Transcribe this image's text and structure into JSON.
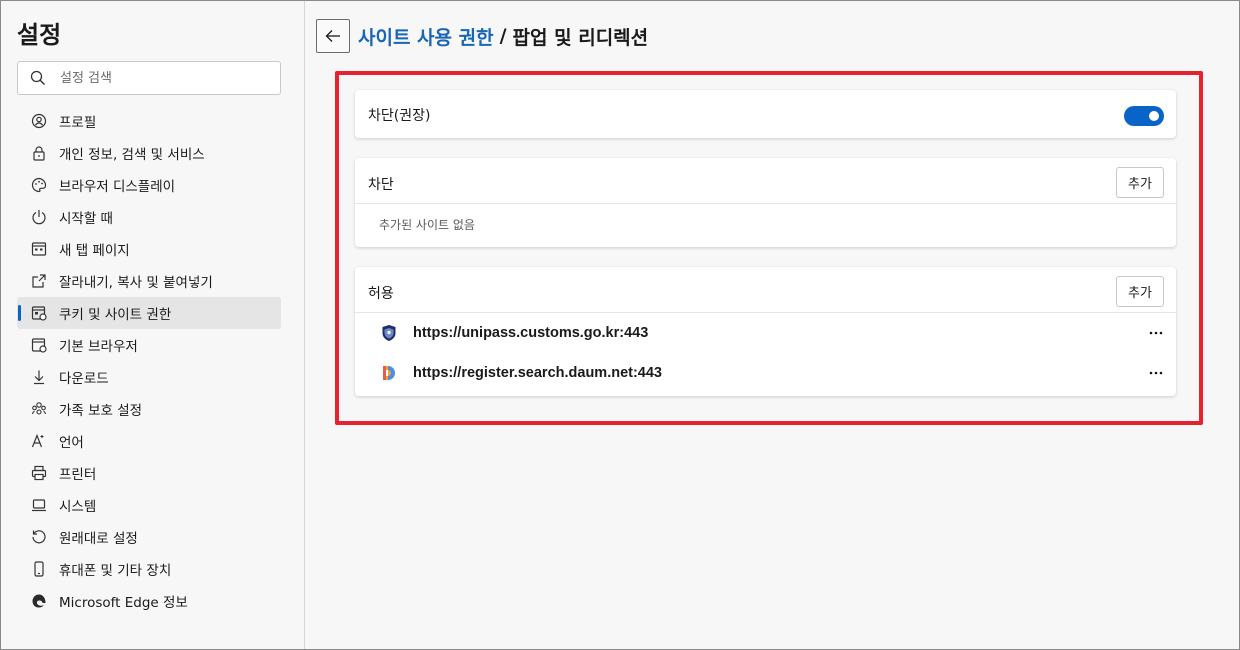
{
  "sidebar": {
    "title": "설정",
    "search_placeholder": "설정 검색",
    "items": [
      {
        "label": "프로필",
        "icon": "profile-icon"
      },
      {
        "label": "개인 정보, 검색 및 서비스",
        "icon": "lock-icon"
      },
      {
        "label": "브라우저 디스플레이",
        "icon": "palette-icon"
      },
      {
        "label": "시작할 때",
        "icon": "power-icon"
      },
      {
        "label": "새 탭 페이지",
        "icon": "grid-icon"
      },
      {
        "label": "잘라내기, 복사 및 붙여넣기",
        "icon": "share-icon"
      },
      {
        "label": "쿠키 및 사이트 권한",
        "icon": "cookie-permissions-icon"
      },
      {
        "label": "기본 브라우저",
        "icon": "browser-icon"
      },
      {
        "label": "다운로드",
        "icon": "download-icon"
      },
      {
        "label": "가족 보호 설정",
        "icon": "family-icon"
      },
      {
        "label": "언어",
        "icon": "language-icon"
      },
      {
        "label": "프린터",
        "icon": "printer-icon"
      },
      {
        "label": "시스템",
        "icon": "laptop-icon"
      },
      {
        "label": "원래대로 설정",
        "icon": "reset-icon"
      },
      {
        "label": "휴대폰 및 기타 장치",
        "icon": "phone-icon"
      },
      {
        "label": "Microsoft Edge 정보",
        "icon": "edge-icon"
      }
    ],
    "active_index": 6
  },
  "header": {
    "breadcrumb_parent": "사이트 사용 권한",
    "separator": "/",
    "breadcrumb_current": "팝업 및 리디렉션"
  },
  "main": {
    "block_toggle": {
      "label": "차단(권장)",
      "on": true
    },
    "block_section": {
      "title": "차단",
      "add_label": "추가",
      "empty_text": "추가된 사이트 없음"
    },
    "allow_section": {
      "title": "허용",
      "add_label": "추가",
      "sites": [
        {
          "url": "https://unipass.customs.go.kr:443",
          "favicon": "customs-shield-icon"
        },
        {
          "url": "https://register.search.daum.net:443",
          "favicon": "daum-icon"
        }
      ]
    }
  },
  "colors": {
    "accent": "#0a64c8",
    "link": "#1866b4",
    "highlight_border": "#e8212f"
  }
}
